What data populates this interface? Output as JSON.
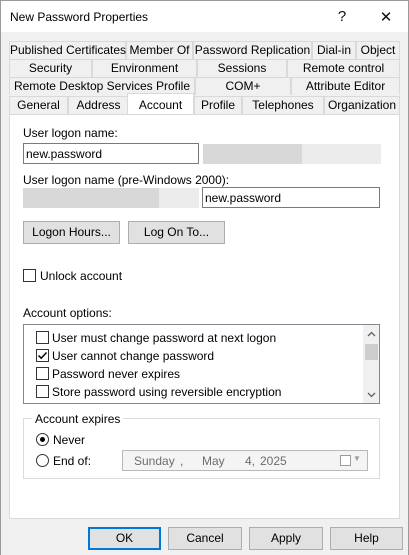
{
  "window": {
    "title": "New Password Properties",
    "help_glyph": "?",
    "close_glyph": "✕"
  },
  "tabs": {
    "row1": [
      "Published Certificates",
      "Member Of",
      "Password Replication",
      "Dial-in",
      "Object"
    ],
    "row2": [
      "Security",
      "Environment",
      "Sessions",
      "Remote control"
    ],
    "row3": [
      "Remote Desktop Services Profile",
      "COM+",
      "Attribute Editor"
    ],
    "row4": [
      "General",
      "Address",
      "Account",
      "Profile",
      "Telephones",
      "Organization"
    ],
    "active": "Account"
  },
  "account": {
    "logon_name_label": "User logon name:",
    "logon_name_value": "new.password",
    "pre2000_label": "User logon name (pre-Windows 2000):",
    "pre2000_value": "new.password",
    "logon_hours_button": "Logon Hours...",
    "logon_to_button": "Log On To...",
    "unlock_label": "Unlock account",
    "unlock_checked": false,
    "options_label": "Account options:",
    "options": [
      {
        "label": "User must change password at next logon",
        "checked": false
      },
      {
        "label": "User cannot change password",
        "checked": true
      },
      {
        "label": "Password never expires",
        "checked": false
      },
      {
        "label": "Store password using reversible encryption",
        "checked": false
      }
    ],
    "expires": {
      "group_label": "Account expires",
      "never_label": "Never",
      "never_selected": true,
      "endof_label": "End of:",
      "date": {
        "weekday": "Sunday",
        "sep": ",",
        "month": "May",
        "day": "4,",
        "year": "2025"
      }
    }
  },
  "buttons": {
    "ok": "OK",
    "cancel": "Cancel",
    "apply": "Apply",
    "help": "Help"
  },
  "icons": {
    "scroll_up": "chevron-up-icon",
    "scroll_down": "chevron-down-icon",
    "calendar": "calendar-icon"
  },
  "colors": {
    "accent": "#0078d7",
    "panel": "#ffffff",
    "chrome": "#f0f0f0"
  }
}
